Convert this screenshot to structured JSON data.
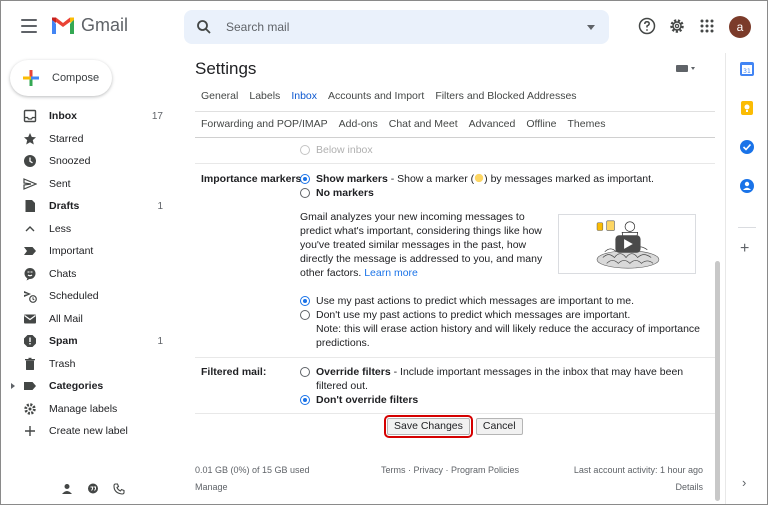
{
  "app": {
    "name": "Gmail",
    "user_initial": "a"
  },
  "search": {
    "placeholder": "Search mail"
  },
  "compose": {
    "label": "Compose"
  },
  "sidebar": {
    "items": [
      {
        "label": "Inbox",
        "count": "17",
        "icon": "inbox-icon",
        "bold": true
      },
      {
        "label": "Starred",
        "count": "",
        "icon": "star-icon",
        "bold": false
      },
      {
        "label": "Snoozed",
        "count": "",
        "icon": "clock-icon",
        "bold": false
      },
      {
        "label": "Sent",
        "count": "",
        "icon": "send-icon",
        "bold": false
      },
      {
        "label": "Drafts",
        "count": "1",
        "icon": "draft-icon",
        "bold": true
      },
      {
        "label": "Less",
        "count": "",
        "icon": "chevron-up-icon",
        "bold": false
      },
      {
        "label": "Important",
        "count": "",
        "icon": "important-icon",
        "bold": false
      },
      {
        "label": "Chats",
        "count": "",
        "icon": "chat-icon",
        "bold": false
      },
      {
        "label": "Scheduled",
        "count": "",
        "icon": "scheduled-icon",
        "bold": false
      },
      {
        "label": "All Mail",
        "count": "",
        "icon": "mail-icon",
        "bold": false
      },
      {
        "label": "Spam",
        "count": "1",
        "icon": "spam-icon",
        "bold": true
      },
      {
        "label": "Trash",
        "count": "",
        "icon": "trash-icon",
        "bold": false
      },
      {
        "label": "Categories",
        "count": "",
        "icon": "label-icon",
        "bold": true
      },
      {
        "label": "Manage labels",
        "count": "",
        "icon": "gear-icon",
        "bold": false
      },
      {
        "label": "Create new label",
        "count": "",
        "icon": "plus-icon",
        "bold": false
      }
    ]
  },
  "settings": {
    "title": "Settings",
    "tabs_row1": [
      "General",
      "Labels",
      "Inbox",
      "Accounts and Import",
      "Filters and Blocked Addresses"
    ],
    "tabs_row2": [
      "Forwarding and POP/IMAP",
      "Add-ons",
      "Chat and Meet",
      "Advanced",
      "Offline",
      "Themes"
    ],
    "active_tab": "Inbox",
    "below_inbox": "Below inbox",
    "importance": {
      "label": "Importance markers:",
      "show_markers": "Show markers",
      "show_markers_desc": " - Show a marker (",
      "show_markers_desc2": ") by messages marked as important.",
      "no_markers": "No markers",
      "explain": "Gmail analyzes your new incoming messages to predict what's important, considering things like how you've treated similar messages in the past, how directly the message is addressed to you, and many other factors.",
      "learn_more": "Learn more",
      "use_past": "Use my past actions to predict which messages are important to me.",
      "dont_use_past": "Don't use my past actions to predict which messages are important.",
      "note": "Note: this will erase action history and will likely reduce the accuracy of importance predictions."
    },
    "filtered": {
      "label": "Filtered mail:",
      "override": "Override filters",
      "override_desc": " - Include important messages in the inbox that may have been filtered out.",
      "dont_override": "Don't override filters"
    },
    "save_label": "Save Changes",
    "cancel_label": "Cancel"
  },
  "footer": {
    "storage": "0.01 GB (0%) of 15 GB used",
    "manage": "Manage",
    "links": "Terms · Privacy · Program Policies",
    "last_activity": "Last account activity: 1 hour ago",
    "details": "Details"
  },
  "colors": {
    "accent": "#1a73e8",
    "save_outline": "#d50000"
  }
}
